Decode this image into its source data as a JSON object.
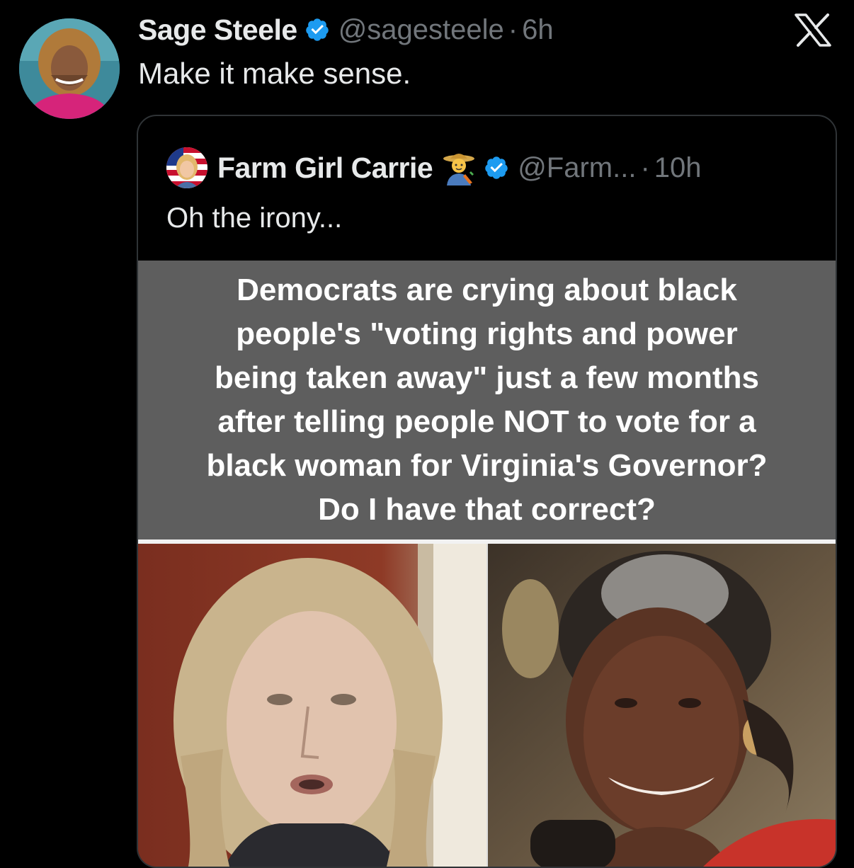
{
  "tweet": {
    "author": {
      "display_name": "Sage Steele",
      "handle": "@sagesteele",
      "verified": true,
      "avatar_icon": "profile-photo"
    },
    "separator": "·",
    "time": "6h",
    "text": "Make it make sense.",
    "platform_icon": "x-logo-icon"
  },
  "quoted_tweet": {
    "author": {
      "display_name": "Farm Girl Carrie",
      "emoji": "farmer-emoji",
      "handle": "@Farm...",
      "verified": true,
      "avatar_icon": "profile-photo"
    },
    "separator": "·",
    "time": "10h",
    "text": "Oh the irony...",
    "media": {
      "caption": "Democrats are crying about black\npeople's \"voting rights and power\nbeing taken away\" just a few months\nafter telling people NOT to vote for a\nblack woman for Virginia's Governor?\nDo I have that correct?",
      "photos": [
        "photo-left",
        "photo-right"
      ]
    }
  },
  "colors": {
    "background": "#000000",
    "text_primary": "#e7e9ea",
    "text_secondary": "#71767b",
    "verified_blue": "#1d9bf0",
    "border": "#2f3336",
    "caption_bg": "#5e5e5e"
  }
}
